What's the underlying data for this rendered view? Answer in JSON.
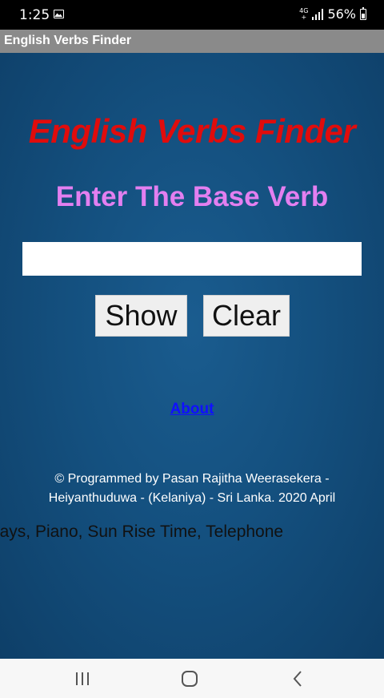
{
  "status_bar": {
    "time": "1:25",
    "network_type_top": "4G",
    "network_type_bottom": "+",
    "battery": "56%",
    "icons": [
      "gallery-icon",
      "signal-icon",
      "battery-icon"
    ]
  },
  "app": {
    "title": "English Verbs Finder"
  },
  "main": {
    "heading": "English Verbs Finder",
    "subheading": "Enter The Base Verb",
    "input": {
      "value": "",
      "placeholder": ""
    },
    "show_label": "Show",
    "clear_label": "Clear",
    "about_label": "About",
    "copyright_line1": "© Programmed by Pasan Rajitha Weerasekera -",
    "copyright_line2": "Heiyanthuduwa - (Kelaniya) - Sri Lanka. 2020 April",
    "marquee_text": "Calculator, Age In Days, Piano, Sun Rise Time, Telephone"
  },
  "nav_bar": {
    "icons": [
      "recents-icon",
      "home-icon",
      "back-icon"
    ]
  },
  "colors": {
    "heading": "#e00c0c",
    "subheading": "#e37ff0",
    "background": "#14507f",
    "title_bar": "#8a8a8a",
    "link": "#1010ff"
  }
}
